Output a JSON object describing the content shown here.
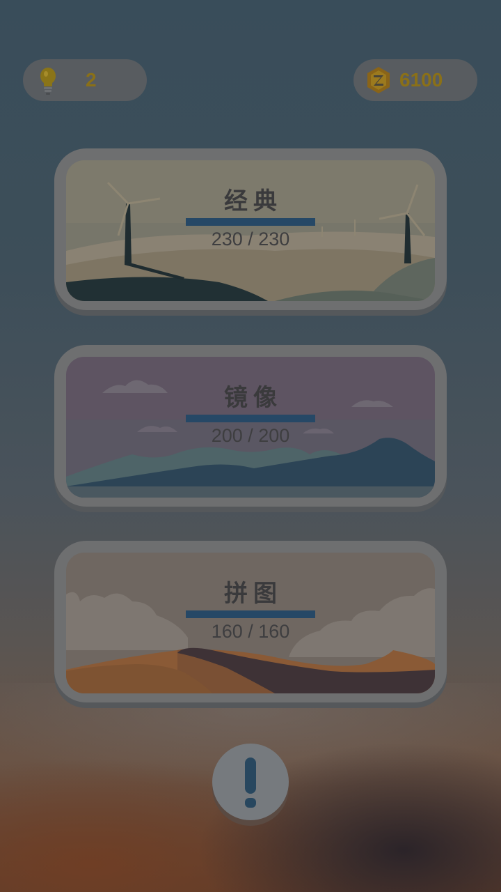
{
  "hud": {
    "hints": {
      "icon": "lightbulb-icon",
      "value": "2"
    },
    "coins": {
      "icon": "coin-icon",
      "value": "6100"
    }
  },
  "modes": [
    {
      "title": "经典",
      "progress": "230 / 230",
      "scene": "wind-turbines"
    },
    {
      "title": "镜像",
      "progress": "200 / 200",
      "scene": "mountains-lake"
    },
    {
      "title": "拼图",
      "progress": "160 / 160",
      "scene": "desert-dunes"
    }
  ],
  "info_button": {
    "icon": "exclamation-icon"
  },
  "colors": {
    "progress_bar": "#264866",
    "hud_text": "#8a7018"
  }
}
